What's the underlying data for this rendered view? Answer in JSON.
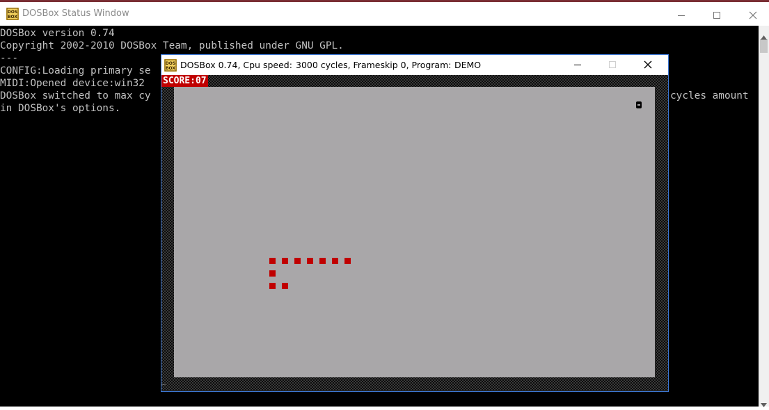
{
  "status_window": {
    "title": "DOSBox Status Window",
    "console_lines": [
      "DOSBox version 0.74",
      "Copyright 2002-2010 DOSBox Team, published under GNU GPL.",
      "---",
      "CONFIG:Loading primary se",
      "MIDI:Opened device:win32",
      "DOSBox switched to max cy",
      "in DOSBox's options."
    ],
    "console_tail": "cycles amount"
  },
  "dos_window": {
    "title_app": "DOSBox 0.74, Cpu speed:",
    "title_cycles": "3000 cycles, Frameskip  0, Program:",
    "title_program": "DEMO",
    "score": "SCORE:07"
  },
  "icons": {
    "app": "dosbox-icon",
    "minimize": "minimize-icon",
    "maximize": "maximize-icon",
    "close": "close-icon"
  },
  "colors": {
    "snake": "#c00000",
    "playfield": "#a9a7a9",
    "console_text": "#c0c0c0",
    "window_border": "#3c78d6"
  },
  "game": {
    "snake_segments": 10
  }
}
